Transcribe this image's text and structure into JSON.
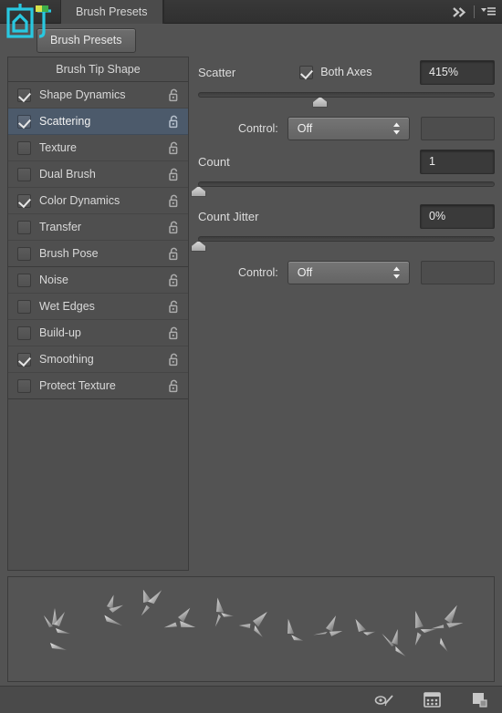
{
  "window": {
    "title": "Brush Presets",
    "collapse_icon": "double-chevron-right-icon",
    "menu_icon": "panel-menu-icon"
  },
  "toolbar": {
    "presets_button": "Brush Presets"
  },
  "sidebar": {
    "header": "Brush Tip Shape",
    "items": [
      {
        "label": "Shape Dynamics",
        "checked": true,
        "selected": false,
        "locked": false
      },
      {
        "label": "Scattering",
        "checked": true,
        "selected": true,
        "locked": false
      },
      {
        "label": "Texture",
        "checked": false,
        "selected": false,
        "locked": false
      },
      {
        "label": "Dual Brush",
        "checked": false,
        "selected": false,
        "locked": false
      },
      {
        "label": "Color Dynamics",
        "checked": true,
        "selected": false,
        "locked": false
      },
      {
        "label": "Transfer",
        "checked": false,
        "selected": false,
        "locked": false
      },
      {
        "label": "Brush Pose",
        "checked": false,
        "selected": false,
        "locked": false
      },
      {
        "label": "Noise",
        "checked": false,
        "selected": false,
        "locked": false
      },
      {
        "label": "Wet Edges",
        "checked": false,
        "selected": false,
        "locked": false
      },
      {
        "label": "Build-up",
        "checked": false,
        "selected": false,
        "locked": false
      },
      {
        "label": "Smoothing",
        "checked": true,
        "selected": false,
        "locked": false
      },
      {
        "label": "Protect Texture",
        "checked": false,
        "selected": false,
        "locked": false
      }
    ]
  },
  "scattering": {
    "scatter": {
      "label": "Scatter",
      "both_axes_label": "Both Axes",
      "both_axes_checked": true,
      "value": "415%",
      "slider_percent": 41,
      "control_label": "Control:",
      "control_value": "Off"
    },
    "count": {
      "label": "Count",
      "value": "1",
      "slider_percent": 0
    },
    "count_jitter": {
      "label": "Count Jitter",
      "value": "0%",
      "slider_percent": 0,
      "control_label": "Control:",
      "control_value": "Off"
    }
  },
  "bottom_bar": {
    "icons": [
      {
        "name": "toggle-brush-preview-icon"
      },
      {
        "name": "brush-panel-icon"
      },
      {
        "name": "new-brush-icon"
      }
    ]
  },
  "colors": {
    "panel_bg": "#535353",
    "titlebar_bg": "#343434",
    "selected_row": "#4c5a6b",
    "field_bg": "#3a3a3a",
    "text": "#d9d9d9",
    "watermark_accent": "#29c8e0"
  }
}
